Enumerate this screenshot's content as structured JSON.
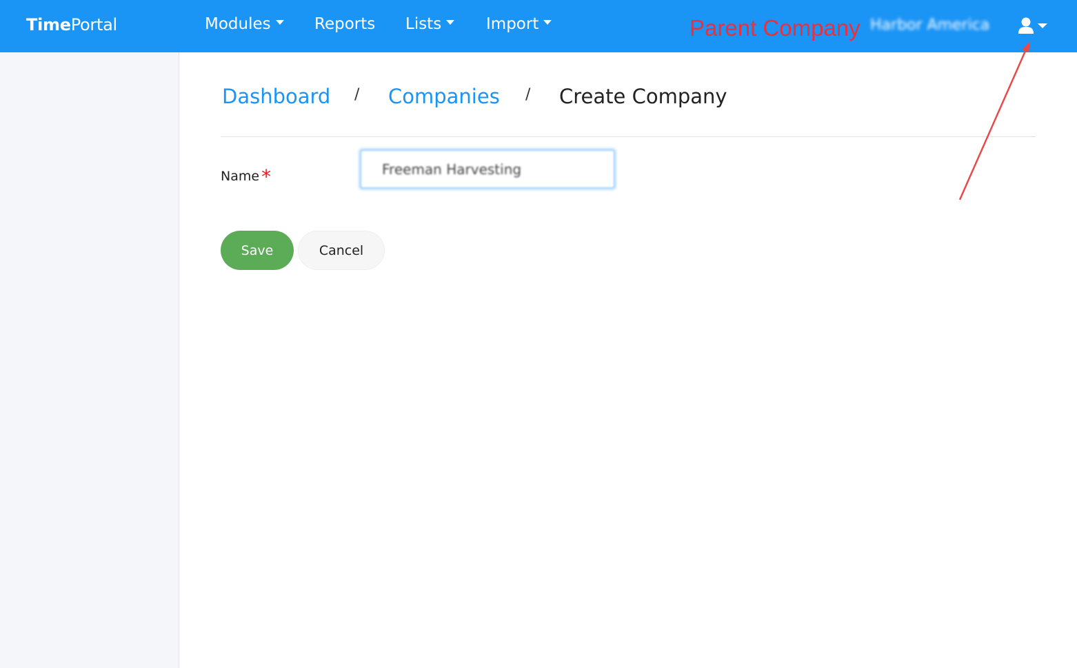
{
  "app": {
    "brand_bold": "Time",
    "brand_light": "Portal"
  },
  "nav": {
    "modules": "Modules",
    "reports": "Reports",
    "lists": "Lists",
    "import": "Import",
    "parent_company_annotation": "Parent Company",
    "company_name": "Harbor America",
    "user_icon": "user-icon",
    "caret_icon": "caret-down-icon"
  },
  "breadcrumb": {
    "dashboard": "Dashboard",
    "sep1": "/",
    "companies": "Companies",
    "sep2": "/",
    "current": "Create Company"
  },
  "form": {
    "name_label": "Name",
    "required_marker": "*",
    "name_value": "Freeman Harvesting"
  },
  "buttons": {
    "save": "Save",
    "cancel": "Cancel"
  },
  "colors": {
    "navbar": "#1a94f5",
    "link": "#1a94f5",
    "save": "#5cab56",
    "annotation": "#e8313f"
  }
}
